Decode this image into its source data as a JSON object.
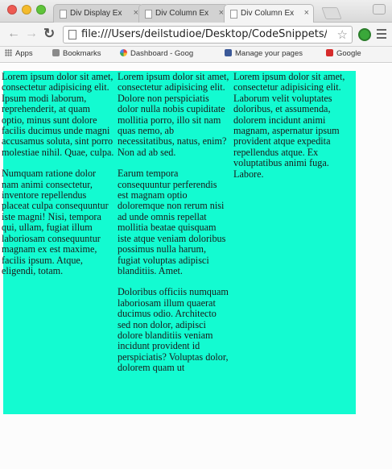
{
  "browser": {
    "tabs": [
      {
        "label": "Div Display Ex",
        "active": false
      },
      {
        "label": "Div Column Ex",
        "active": false
      },
      {
        "label": "Div Column Ex",
        "active": true
      }
    ],
    "url": "file:///Users/deilstudioe/Desktop/CodeSnippets/...",
    "bookmarks": {
      "apps": "Apps",
      "bookmarks": "Bookmarks",
      "dashboard": "Dashboard - Goog",
      "manage": "Manage your pages",
      "google": "Google"
    }
  },
  "colors": {
    "column_background": "#13fbd1"
  },
  "columns": [
    {
      "paragraphs": [
        "Lorem ipsum dolor sit amet, consectetur adipisicing elit. Ipsum modi laborum, reprehenderit, at quam optio, minus sunt dolore facilis ducimus unde magni accusamus soluta, sint porro molestiae nihil. Quae, culpa.",
        "Numquam ratione dolor nam animi consectetur, inventore repellendus placeat culpa consequuntur iste magni! Nisi, tempora qui, ullam, fugiat illum laboriosam consequuntur magnam ex est maxime, facilis ipsum. Atque, eligendi, totam."
      ]
    },
    {
      "paragraphs": [
        "Lorem ipsum dolor sit amet, consectetur adipisicing elit. Dolore non perspiciatis dolor nulla nobis cupiditate mollitia porro, illo sit nam quas nemo, ab necessitatibus, natus, enim? Non ad ab sed.",
        "Earum tempora consequuntur perferendis est magnam optio doloremque non rerum nisi ad unde omnis repellat mollitia beatae quisquam iste atque veniam doloribus possimus nulla harum, fugiat voluptas adipisci blanditiis. Amet.",
        "Doloribus officiis numquam laboriosam illum quaerat ducimus odio. Architecto sed non dolor, adipisci dolore blanditiis veniam incidunt provident id perspiciatis? Voluptas dolor, dolorem quam ut"
      ]
    },
    {
      "paragraphs": [
        "Lorem ipsum dolor sit amet, consectetur adipisicing elit. Laborum velit voluptates doloribus, et assumenda, dolorem incidunt animi magnam, aspernatur ipsum provident atque expedita repellendus atque. Ex voluptatibus animi fuga. Labore."
      ]
    }
  ]
}
